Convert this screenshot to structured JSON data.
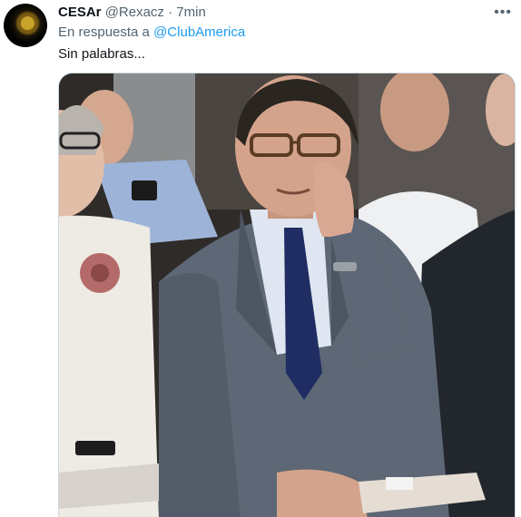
{
  "tweet": {
    "display_name": "CESAr",
    "handle": "@Rexacz",
    "separator": "·",
    "time": "7min",
    "reply_prefix": "En respuesta a",
    "reply_to": "@ClubAmerica",
    "text": "Sin palabras...",
    "more_icon": "more-dots-icon"
  },
  "colors": {
    "link": "#1d9bf0",
    "secondary_text": "#536471",
    "primary_text": "#0f1419"
  }
}
